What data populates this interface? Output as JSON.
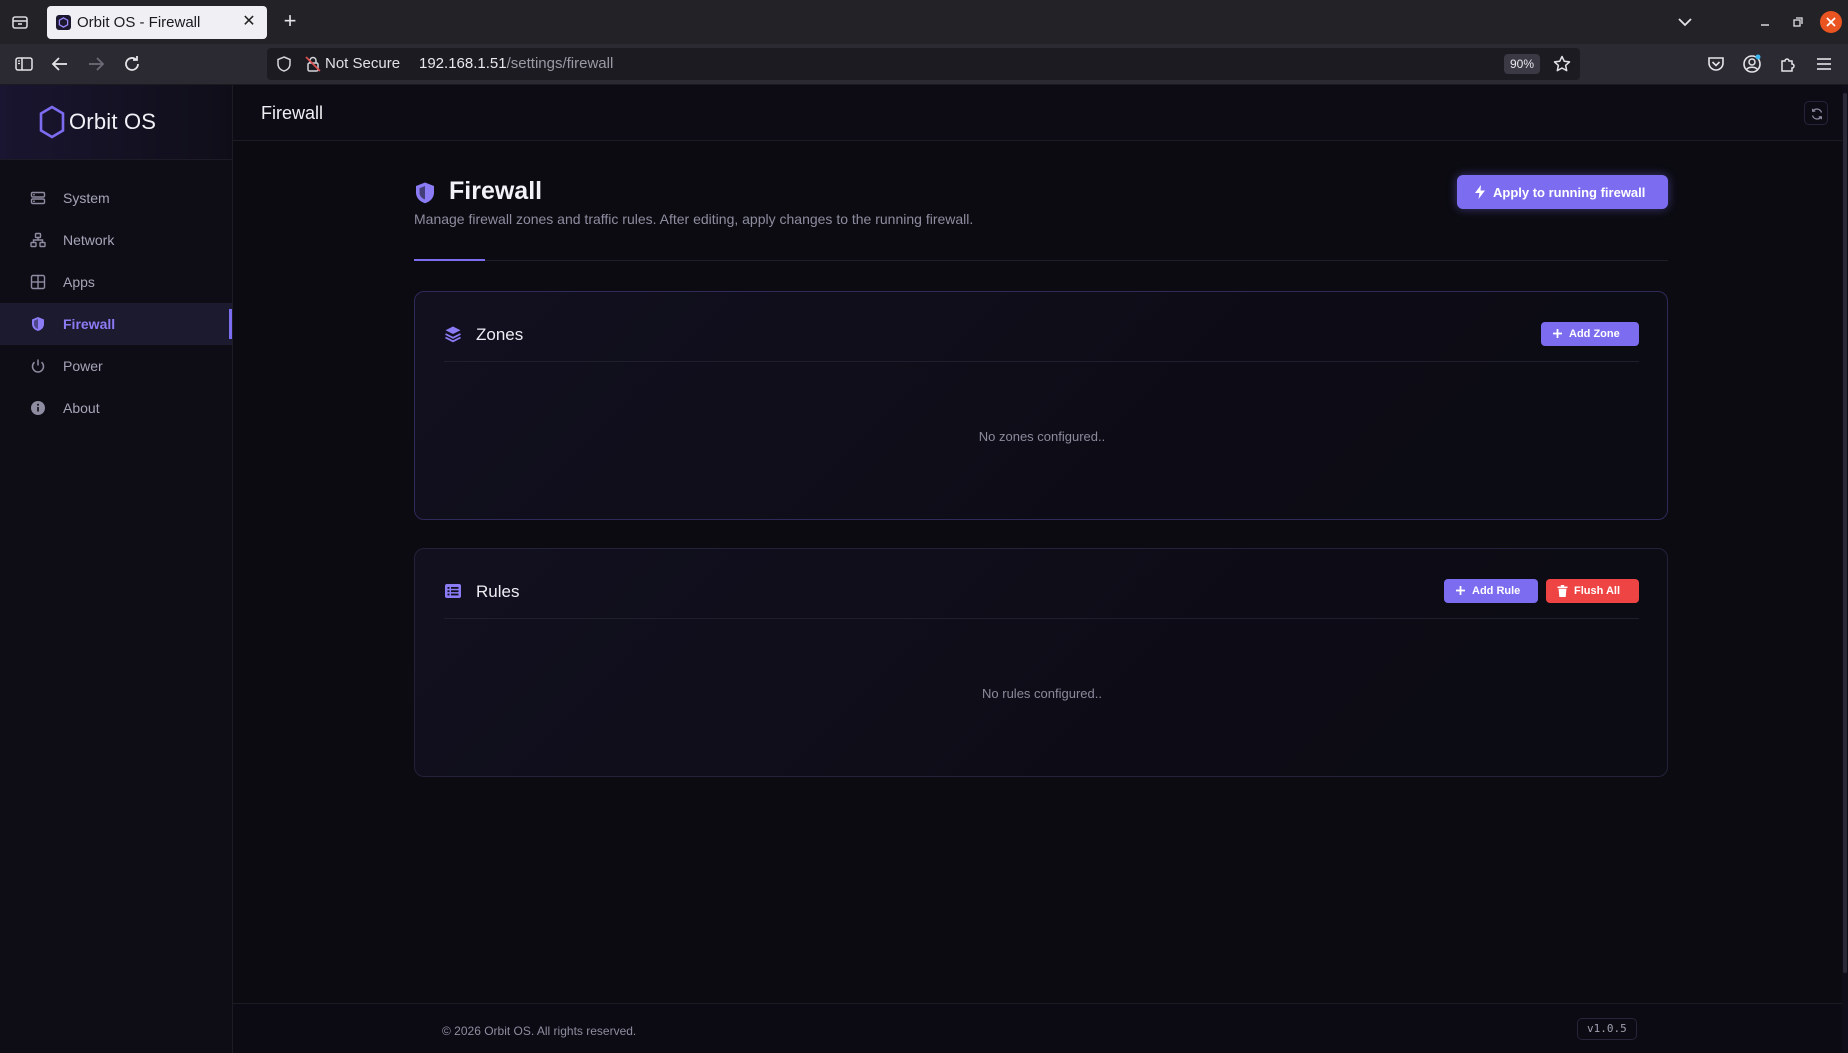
{
  "browser": {
    "tab_title": "Orbit OS - Firewall",
    "url_security": "Not Secure",
    "url_host": "192.168.1.51",
    "url_path": "/settings/firewall",
    "zoom": "90%"
  },
  "app": {
    "brand_name": "Orbit OS",
    "topbar_title": "Firewall",
    "accent_color": "#7c6cf0",
    "danger_color": "#ef4444"
  },
  "sidebar": {
    "items": [
      {
        "label": "System",
        "icon": "server-icon",
        "active": false
      },
      {
        "label": "Network",
        "icon": "network-icon",
        "active": false
      },
      {
        "label": "Apps",
        "icon": "grid-icon",
        "active": false
      },
      {
        "label": "Firewall",
        "icon": "shield-icon",
        "active": true
      },
      {
        "label": "Power",
        "icon": "power-icon",
        "active": false
      },
      {
        "label": "About",
        "icon": "info-icon",
        "active": false
      }
    ]
  },
  "page": {
    "title": "Firewall",
    "description": "Manage firewall zones and traffic rules. After editing, apply changes to the running firewall.",
    "apply_label": "Apply to running firewall"
  },
  "zones": {
    "title": "Zones",
    "add_label": "Add Zone",
    "empty_text": "No zones configured.."
  },
  "rules": {
    "title": "Rules",
    "add_label": "Add Rule",
    "flush_label": "Flush All",
    "empty_text": "No rules configured.."
  },
  "footer": {
    "copyright": "© 2026 Orbit OS. All rights reserved.",
    "version": "v1.0.5"
  }
}
